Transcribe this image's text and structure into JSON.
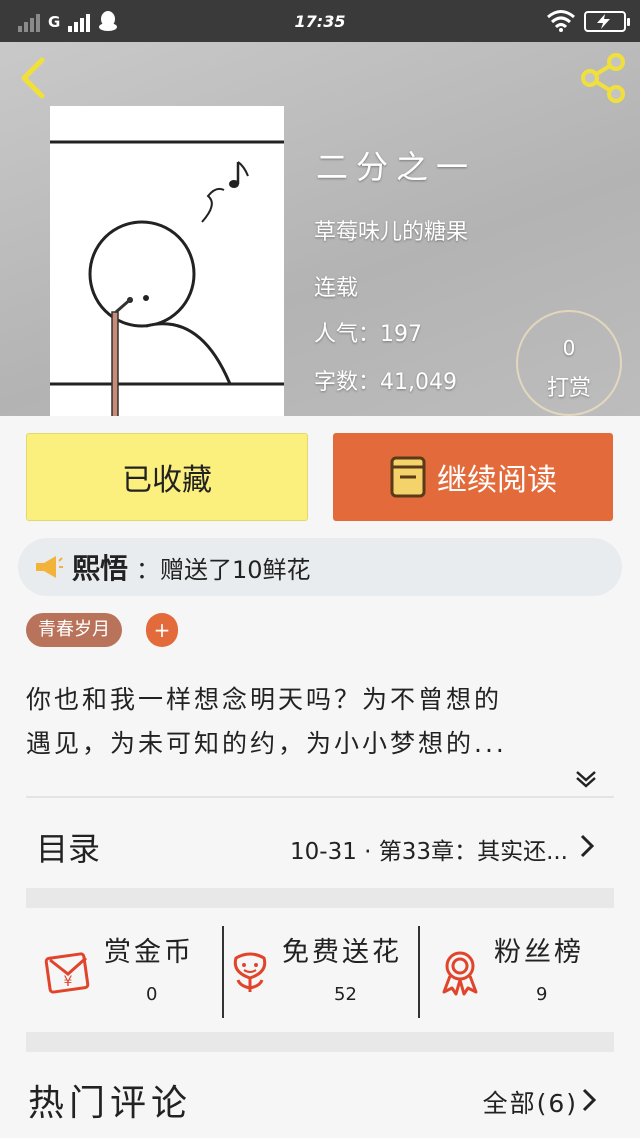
{
  "status_bar": {
    "network": "G",
    "time": "17:35"
  },
  "book": {
    "title": "二分之一",
    "author": "草莓味儿的糖果",
    "status": "连载",
    "popularity": "人气：197",
    "word_count": "字数：41,049"
  },
  "reward": {
    "count": "0",
    "label": "打赏"
  },
  "actions": {
    "collected_label": "已收藏",
    "continue_label": "继续阅读"
  },
  "gift": {
    "user": "熙悟",
    "text": "：赠送了10鲜花"
  },
  "tags": {
    "items": [
      "青春岁月"
    ],
    "add_label": "+"
  },
  "description": {
    "line1": "你也和我一样想念明天吗？为不曾想的",
    "line2": "遇见，为未可知的约，为小小梦想的..."
  },
  "catalog": {
    "label": "目录",
    "latest": "10-31 · 第33章：其实还..."
  },
  "stats": [
    {
      "label": "赏金币",
      "value": "0",
      "icon": "envelope-yen-icon"
    },
    {
      "label": "免费送花",
      "value": "52",
      "icon": "flower-icon"
    },
    {
      "label": "粉丝榜",
      "value": "9",
      "icon": "award-ribbon-icon"
    }
  ],
  "comments": {
    "title": "热门评论",
    "all_label": "全部(6)"
  },
  "colors": {
    "collect_button": "#fbf07e",
    "read_button": "#e36b3b",
    "tag": "#b9735a",
    "icon_red": "#e0452c"
  }
}
